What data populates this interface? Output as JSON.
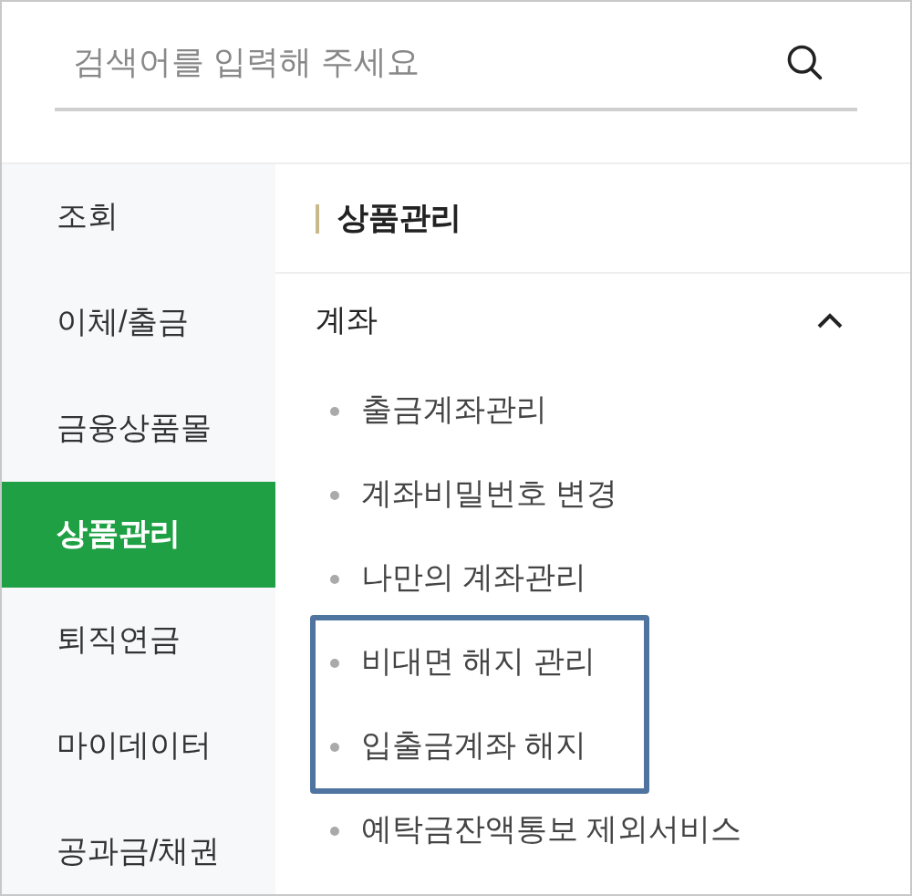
{
  "search": {
    "placeholder": "검색어를 입력해 주세요"
  },
  "sidebar": {
    "items": [
      {
        "label": "조회",
        "selected": false
      },
      {
        "label": "이체/출금",
        "selected": false
      },
      {
        "label": "금융상품몰",
        "selected": false
      },
      {
        "label": "상품관리",
        "selected": true
      },
      {
        "label": "퇴직연금",
        "selected": false
      },
      {
        "label": "마이데이터",
        "selected": false
      },
      {
        "label": "공과금/채권",
        "selected": false
      }
    ]
  },
  "panel": {
    "title": "상품관리",
    "section": {
      "label": "계좌",
      "expanded": true,
      "items": [
        {
          "label": "출금계좌관리",
          "highlighted": false
        },
        {
          "label": "계좌비밀번호 변경",
          "highlighted": false
        },
        {
          "label": "나만의 계좌관리",
          "highlighted": false
        },
        {
          "label": "비대면 해지 관리",
          "highlighted": true
        },
        {
          "label": "입출금계좌 해지",
          "highlighted": true
        },
        {
          "label": "예탁금잔액통보 제외서비스",
          "highlighted": false
        }
      ]
    }
  }
}
